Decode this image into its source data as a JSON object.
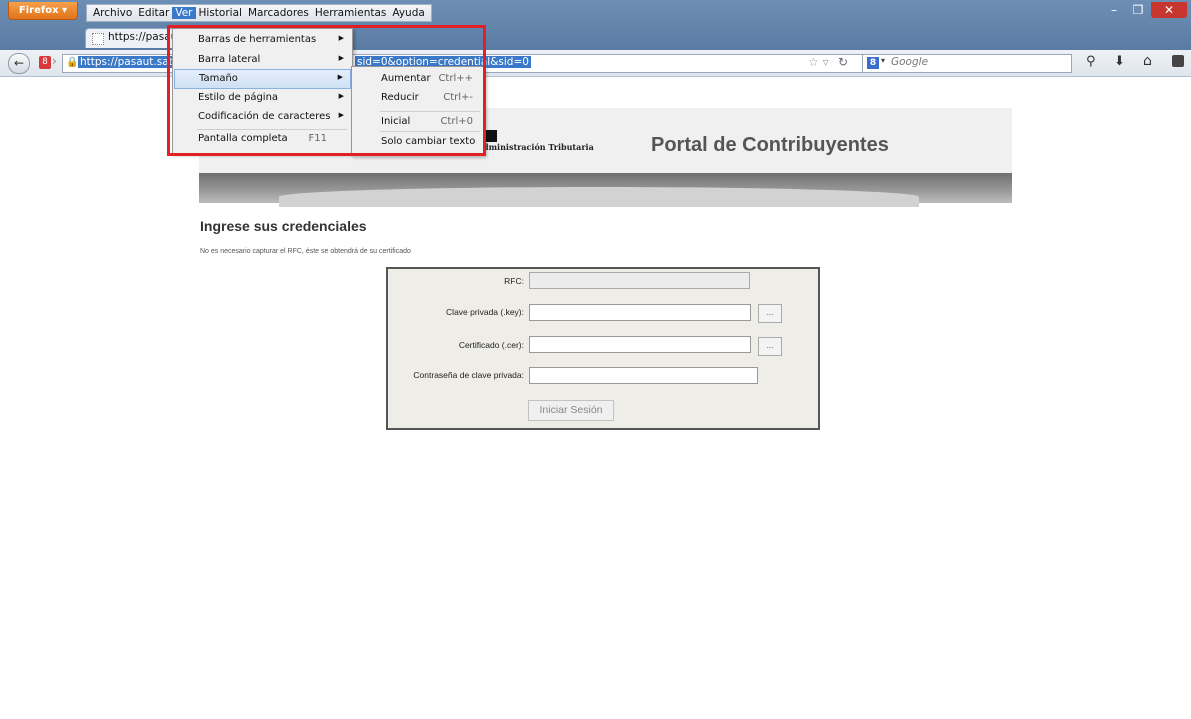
{
  "browser": {
    "app_button": "Firefox",
    "menubar": [
      "Archivo",
      "Editar",
      "Ver",
      "Historial",
      "Marcadores",
      "Herramientas",
      "Ayuda"
    ],
    "tab_title": "https://pasau",
    "url_part1": "https://pasaut.sat.g",
    "url_part2": "sid=0&option=credential&sid=0",
    "search_placeholder": "Google"
  },
  "ver_menu": {
    "items": [
      {
        "label": "Barras de herramientas",
        "submenu": true
      },
      {
        "label": "Barra lateral",
        "submenu": true
      },
      {
        "label": "Tamaño",
        "submenu": true,
        "highlighted": true
      },
      {
        "label": "Estilo de página",
        "submenu": true
      },
      {
        "label": "Codificación de caracteres",
        "submenu": true
      },
      {
        "label": "Pantalla completa",
        "shortcut": "F11"
      }
    ]
  },
  "size_menu": {
    "items": [
      {
        "label": "Aumentar",
        "shortcut": "Ctrl++"
      },
      {
        "label": "Reducir",
        "shortcut": "Ctrl+-"
      },
      {
        "label": "Inicial",
        "shortcut": "Ctrl+0"
      },
      {
        "label": "Solo cambiar texto"
      }
    ]
  },
  "page": {
    "brand_text": "dministración Tributaria",
    "portal_title": "Portal de Contribuyentes",
    "cred_title": "Ingrese sus credenciales",
    "cred_note": "No es necesario capturar el RFC, éste se obtendrá de su certificado",
    "form": {
      "rfc_label": "RFC:",
      "key_label": "Clave privada (.key):",
      "cer_label": "Certificado (.cer):",
      "pwd_label": "Contraseña de clave privada:",
      "browse_label": "...",
      "submit_label": "Iniciar Sesión"
    }
  },
  "colors": {
    "highlight_box": "#e01f26",
    "menu_highlight": "#3a78c8"
  }
}
